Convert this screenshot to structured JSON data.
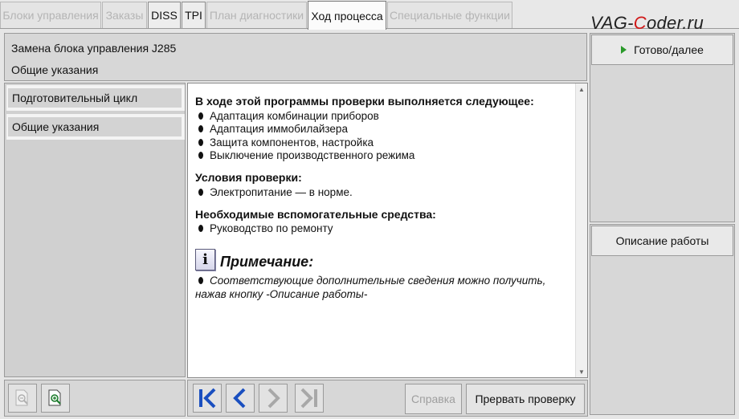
{
  "tabs": [
    {
      "label": "Блоки управления",
      "state": "disabled"
    },
    {
      "label": "Заказы",
      "state": "disabled"
    },
    {
      "label": "DISS",
      "state": "enabled"
    },
    {
      "label": "TPI",
      "state": "enabled"
    },
    {
      "label": "План диагностики",
      "state": "disabled"
    },
    {
      "label": "Ход процесса",
      "state": "active"
    },
    {
      "label": "Специальные функции",
      "state": "disabled"
    }
  ],
  "watermark": {
    "pre": "VAG-",
    "accent": "C",
    "post": "oder.ru"
  },
  "header": {
    "line1": "Замена блока управления J285",
    "line2": "Общие указания"
  },
  "nav": {
    "items": [
      {
        "label": "Подготовительный цикл"
      },
      {
        "label": "Общие указания"
      }
    ]
  },
  "content": {
    "heading": "В ходе этой программы проверки выполняется следующее:",
    "steps": [
      "Адаптация комбинации приборов",
      "Адаптация иммобилайзера",
      "Защита компонентов, настройка",
      "Выключение производственного режима"
    ],
    "conditions_heading": "Условия проверки:",
    "conditions": [
      "Электропитание — в норме."
    ],
    "aids_heading": "Необходимые вспомогательные средства:",
    "aids": [
      "Руководство по ремонту"
    ],
    "note_icon": "i",
    "note_title": "Примечание:",
    "note_line1": "Соответствующие дополнительные сведения можно получить,",
    "note_line2": "нажав кнопку -Описание работы-"
  },
  "right": {
    "done_label": "Готово/далее",
    "description_label": "Описание работы"
  },
  "bottom": {
    "help_label": "Справка",
    "abort_label": "Прервать проверку"
  },
  "colors": {
    "accent_green": "#2a9a2a",
    "nav_blue": "#1a4fc0",
    "watermark_red": "#d01818"
  }
}
